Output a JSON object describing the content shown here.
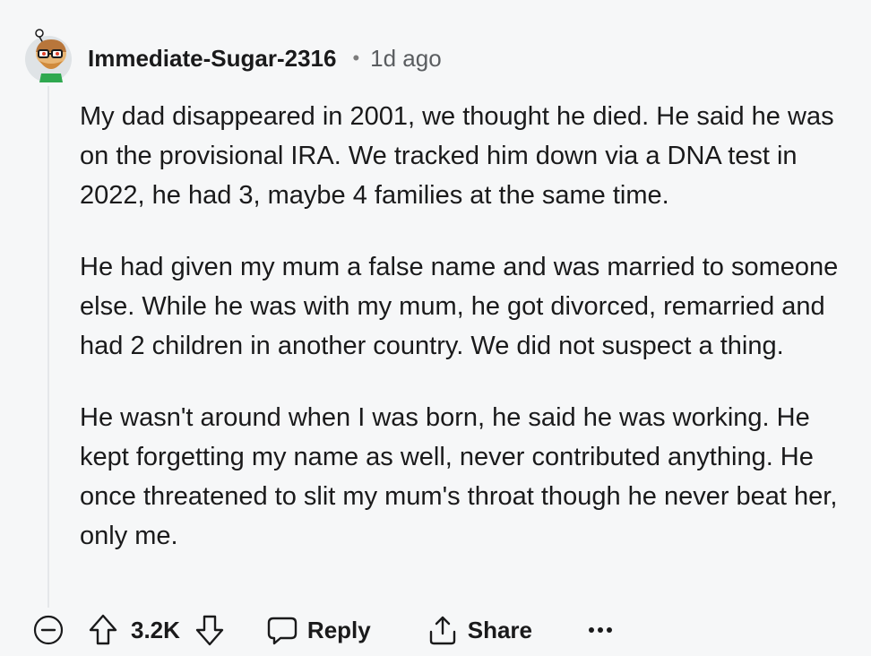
{
  "comment": {
    "author": "Immediate-Sugar-2316",
    "separator": "•",
    "timestamp": "1d ago",
    "paragraphs": [
      "My dad disappeared in 2001, we thought he died. He said he was on the provisional IRA. We tracked him down via a DNA test in 2022, he had 3, maybe 4 families at the same time.",
      "He had given my mum a false name and was married to someone else. While he was with my mum, he got divorced, remarried and had 2 children in another country. We did not suspect a thing.",
      "He wasn't around when I was born, he said he was working. He kept forgetting my name as well, never contributed anything. He once threatened to slit my mum's throat though he never beat her, only me."
    ]
  },
  "actions": {
    "collapse_icon": "collapse-minus-icon",
    "upvote_icon": "upvote-arrow-icon",
    "score": "3.2K",
    "downvote_icon": "downvote-arrow-icon",
    "reply_label": "Reply",
    "share_label": "Share",
    "more_icon": "more-dots-icon"
  },
  "colors": {
    "background": "#f6f7f8",
    "text": "#1a1a1b",
    "muted": "#5a5d60",
    "thread_line": "#e5e7ea"
  }
}
